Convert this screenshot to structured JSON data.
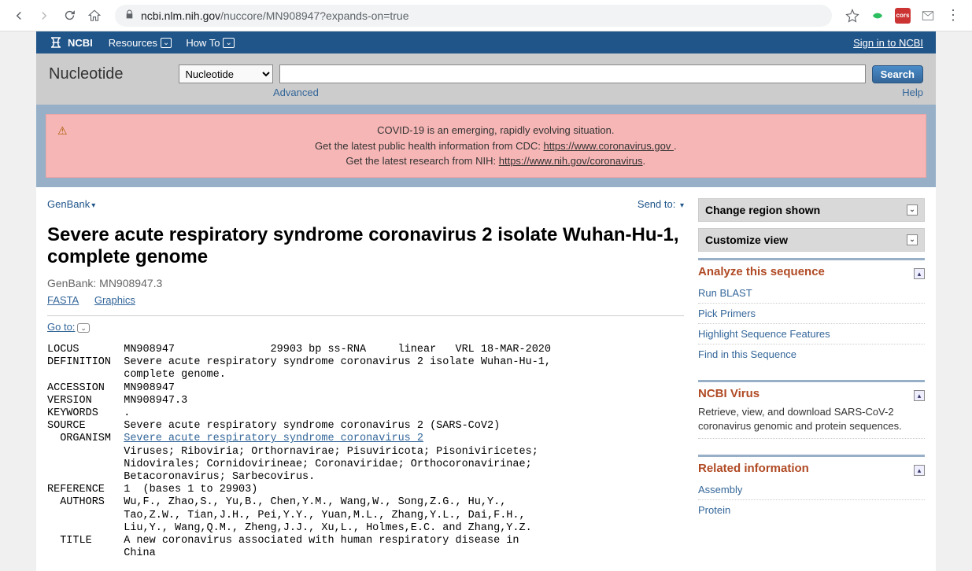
{
  "browser": {
    "url_host": "ncbi.nlm.nih.gov",
    "url_path": "/nuccore/MN908947?expands-on=true"
  },
  "header": {
    "logo": "NCBI",
    "menu": [
      "Resources",
      "How To"
    ],
    "signin": "Sign in to NCBI"
  },
  "search": {
    "db_label": "Nucleotide",
    "db_selected": "Nucleotide",
    "advanced": "Advanced",
    "button": "Search",
    "help": "Help"
  },
  "alert": {
    "line1": "COVID-19 is an emerging, rapidly evolving situation.",
    "line2a": "Get the latest public health information from CDC: ",
    "link2": "https://www.coronavirus.gov ",
    "line2b": ".",
    "line3a": "Get the latest research from NIH: ",
    "link3": "https://www.nih.gov/coronavirus",
    "line3b": "."
  },
  "content": {
    "format": "GenBank",
    "sendto": "Send to:",
    "title": "Severe acute respiratory syndrome coronavirus 2 isolate Wuhan-Hu-1, complete genome",
    "subtitle": "GenBank: MN908947.3",
    "links": [
      "FASTA",
      "Graphics"
    ],
    "goto": "Go to:",
    "record_pre": "LOCUS       MN908947               29903 bp ss-RNA     linear   VRL 18-MAR-2020\nDEFINITION  Severe acute respiratory syndrome coronavirus 2 isolate Wuhan-Hu-1,\n            complete genome.\nACCESSION   MN908947\nVERSION     MN908947.3\nKEYWORDS    .\nSOURCE      Severe acute respiratory syndrome coronavirus 2 (SARS-CoV2)\n  ORGANISM  ",
    "organism_link": "Severe acute respiratory syndrome coronavirus 2",
    "record_post": "\n            Viruses; Riboviria; Orthornavirae; Pisuviricota; Pisoniviricetes;\n            Nidovirales; Cornidovirineae; Coronaviridae; Orthocoronavirinae;\n            Betacoronavirus; Sarbecovirus.\nREFERENCE   1  (bases 1 to 29903)\n  AUTHORS   Wu,F., Zhao,S., Yu,B., Chen,Y.M., Wang,W., Song,Z.G., Hu,Y.,\n            Tao,Z.W., Tian,J.H., Pei,Y.Y., Yuan,M.L., Zhang,Y.L., Dai,F.H.,\n            Liu,Y., Wang,Q.M., Zheng,J.J., Xu,L., Holmes,E.C. and Zhang,Y.Z.\n  TITLE     A new coronavirus associated with human respiratory disease in\n            China"
  },
  "sidebar": {
    "region": "Change region shown",
    "customize": "Customize view",
    "analyze": {
      "title": "Analyze this sequence",
      "links": [
        "Run BLAST",
        "Pick Primers",
        "Highlight Sequence Features",
        "Find in this Sequence"
      ]
    },
    "virus": {
      "title": "NCBI Virus",
      "text": "Retrieve, view, and download SARS-CoV-2 coronavirus genomic and protein sequences."
    },
    "related": {
      "title": "Related information",
      "links": [
        "Assembly",
        "Protein"
      ]
    }
  }
}
